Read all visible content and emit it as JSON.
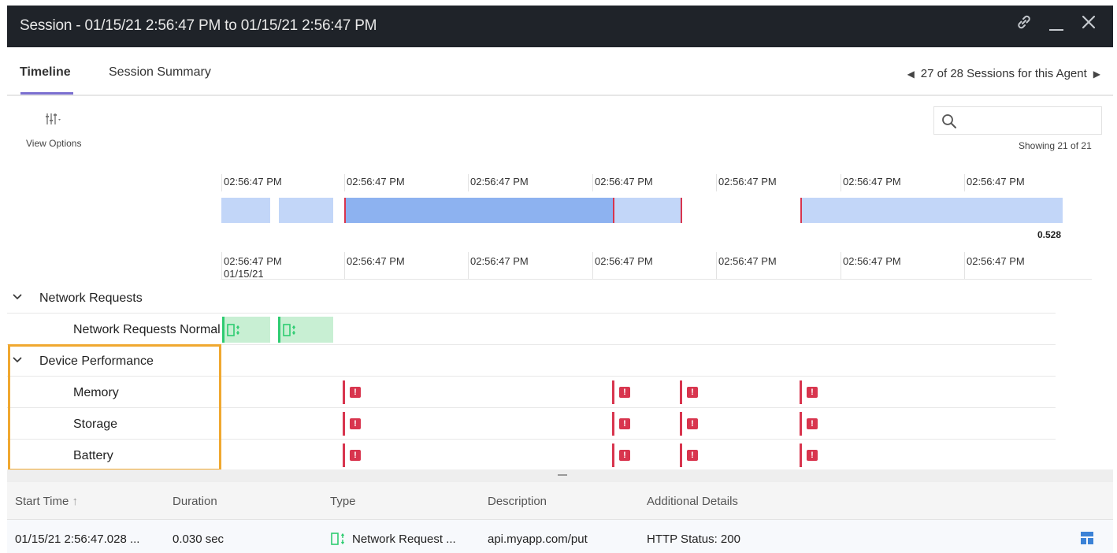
{
  "window": {
    "title": "Session - 01/15/21 2:56:47 PM to 01/15/21 2:56:47 PM",
    "link_icon": "link-icon",
    "minimize_icon": "minimize-icon",
    "close_icon": "close-icon"
  },
  "tabs": [
    {
      "label": "Timeline",
      "active": true
    },
    {
      "label": "Session Summary",
      "active": false
    }
  ],
  "pager": {
    "text": "27 of 28 Sessions for this Agent",
    "prev_icon": "triangle-left-icon",
    "next_icon": "triangle-right-icon"
  },
  "toolbar": {
    "view_options_label": "View Options",
    "view_options_icon": "sliders-icon",
    "search_placeholder": "",
    "search_icon": "search-icon",
    "showing_text": "Showing 21 of 21"
  },
  "timeline": {
    "top_ticks": [
      "02:56:47 PM",
      "02:56:47 PM",
      "02:56:47 PM",
      "02:56:47 PM",
      "02:56:47 PM",
      "02:56:47 PM",
      "02:56:47 PM"
    ],
    "bottom_ticks": [
      "02:56:47 PM",
      "02:56:47 PM",
      "02:56:47 PM",
      "02:56:47 PM",
      "02:56:47 PM",
      "02:56:47 PM",
      "02:56:47 PM"
    ],
    "bottom_date": "01/15/21",
    "scale_value": "0.528"
  },
  "groups": [
    {
      "label": "Network Requests",
      "expanded": true,
      "rows": [
        {
          "label": "Network Requests Normal"
        }
      ]
    },
    {
      "label": "Device Performance",
      "expanded": true,
      "rows": [
        {
          "label": "Memory"
        },
        {
          "label": "Storage"
        },
        {
          "label": "Battery"
        }
      ]
    }
  ],
  "table": {
    "columns": [
      "Start Time",
      "Duration",
      "Type",
      "Description",
      "Additional Details"
    ],
    "sort_icon": "arrow-up-icon",
    "rows": [
      {
        "start_time": "01/15/21 2:56:47.028 ...",
        "duration": "0.030 sec",
        "type": "Network Request ...",
        "description": "api.myapp.com/put",
        "details": "HTTP Status: 200"
      }
    ]
  },
  "colors": {
    "titlebar": "#1f2329",
    "accent": "#7b6fd0",
    "highlight": "#f0a830",
    "error": "#d8354e",
    "network": "#2ecc71",
    "track_light": "#c2d6f8",
    "track_dark": "#8db2f0"
  }
}
